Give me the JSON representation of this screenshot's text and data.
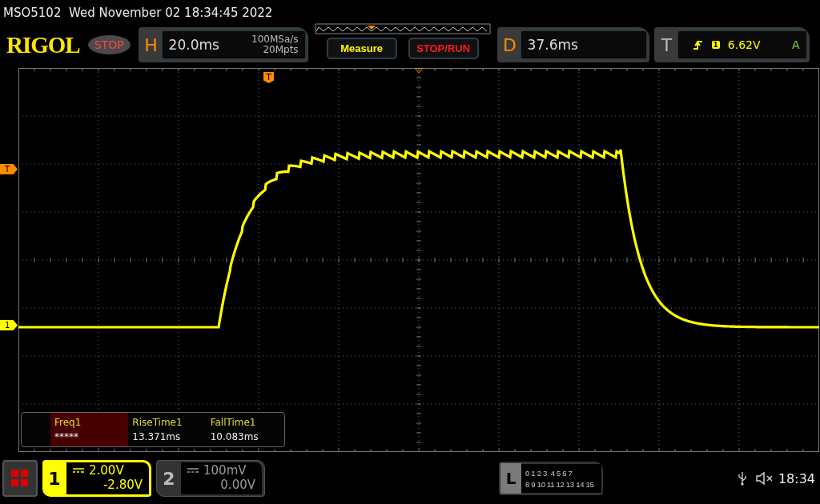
{
  "title": "MSO5102  Wed November 02 18:34:45 2022",
  "logo": "RIGOL",
  "run_state": "STOP",
  "horizontal": {
    "letter": "H",
    "timebase": "20.0ms",
    "sample_rate": "100MSa/s",
    "memory_depth": "20Mpts"
  },
  "buttons": [
    {
      "label": "Measure",
      "color": "#ffff00"
    },
    {
      "label": "STOP/RUN",
      "color": "#ff1a1a"
    }
  ],
  "delay": {
    "letter": "D",
    "value": "37.6ms"
  },
  "trigger": {
    "letter": "T",
    "channel": "1",
    "level": "6.62V",
    "mode": "A"
  },
  "markers": {
    "trigger_position": "T",
    "trigger_level": "T",
    "channel": "1"
  },
  "measurements": [
    {
      "label": "Freq1",
      "value": "*****",
      "selected": true
    },
    {
      "label": "RiseTime1",
      "value": "13.371ms",
      "selected": false
    },
    {
      "label": "FallTime1",
      "value": "10.083ms",
      "selected": false
    }
  ],
  "channels": [
    {
      "number": "1",
      "scale": "2.00V",
      "offset": "-2.80V",
      "on": true
    },
    {
      "number": "2",
      "scale": "100mV",
      "offset": "0.00V",
      "on": false
    }
  ],
  "logic": {
    "letter": "L",
    "row_1": "0 1 2 3  4 5 6 7",
    "row_2": "8 9 10 11 12 13 14 15"
  },
  "clock": "18:34"
}
